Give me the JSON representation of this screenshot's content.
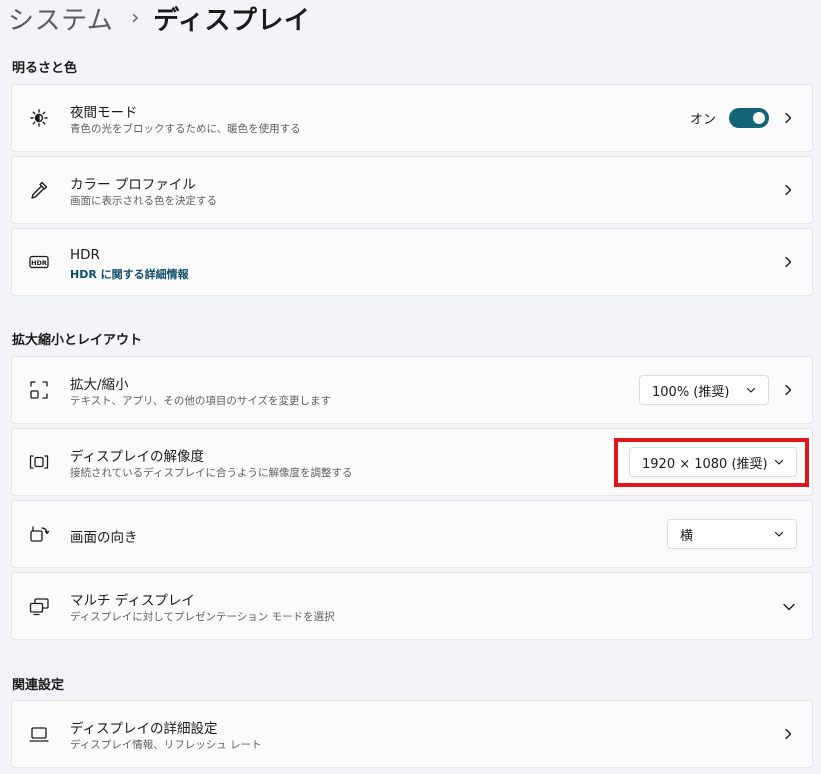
{
  "breadcrumb": {
    "parent": "システム",
    "separator": "›",
    "current": "ディスプレイ"
  },
  "sections": {
    "brightness": "明るさと色",
    "scale_layout": "拡大縮小とレイアウト",
    "related": "関連設定"
  },
  "night_light": {
    "title": "夜間モード",
    "desc": "青色の光をブロックするために、暖色を使用する",
    "state_label": "オン",
    "on": true,
    "icon": "sun-icon"
  },
  "color_profile": {
    "title": "カラー プロファイル",
    "desc": "画面に表示される色を決定する",
    "icon": "eyedropper-icon"
  },
  "hdr": {
    "title": "HDR",
    "link": "HDR に関する詳細情報",
    "icon": "hdr-icon"
  },
  "scale": {
    "title": "拡大/縮小",
    "desc": "テキスト、アプリ、その他の項目のサイズを変更します",
    "value": "100% (推奨)",
    "icon": "scale-icon"
  },
  "resolution": {
    "title": "ディスプレイの解像度",
    "desc": "接続されているディスプレイに合うように解像度を調整する",
    "value": "1920 × 1080 (推奨)",
    "icon": "resolution-icon"
  },
  "orientation": {
    "title": "画面の向き",
    "value": "横",
    "icon": "orientation-icon"
  },
  "multi_display": {
    "title": "マルチ ディスプレイ",
    "desc": "ディスプレイに対してプレゼンテーション モードを選択",
    "icon": "multi-display-icon"
  },
  "advanced_display": {
    "title": "ディスプレイの詳細設定",
    "desc": "ディスプレイ情報、リフレッシュ レート",
    "icon": "monitor-icon"
  },
  "colors": {
    "accent": "#146478",
    "highlight": "#e2141e",
    "link": "#0f4f6b"
  }
}
